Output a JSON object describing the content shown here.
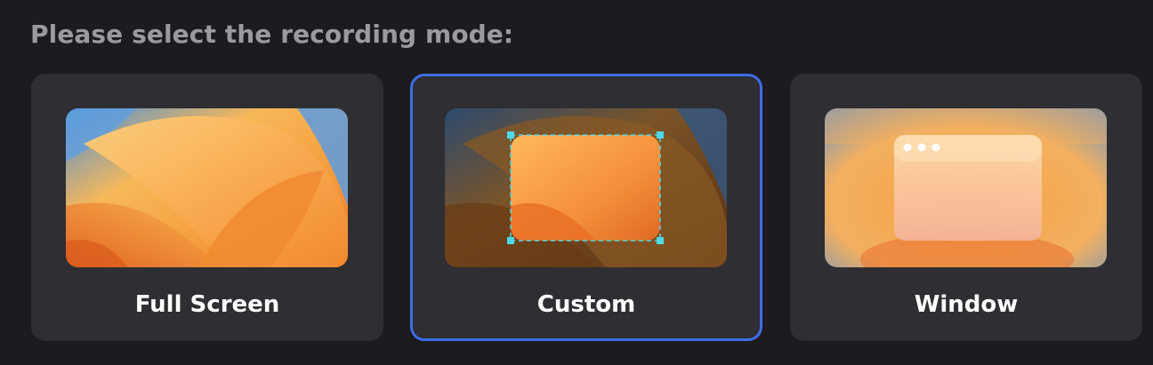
{
  "prompt": {
    "title": "Please select the recording mode:"
  },
  "modes": [
    {
      "label": "Full Screen",
      "icon": "wallpaper-fullscreen-icon",
      "selected": false
    },
    {
      "label": "Custom",
      "icon": "custom-region-icon",
      "selected": true
    },
    {
      "label": "Window",
      "icon": "window-icon",
      "selected": false
    }
  ],
  "colors": {
    "background": "#1c1c20",
    "card": "#2e2e33",
    "selected_border": "#3e6be8",
    "heading": "#9a9aa0",
    "label": "#ffffff",
    "handle": "#4fd8e8"
  }
}
